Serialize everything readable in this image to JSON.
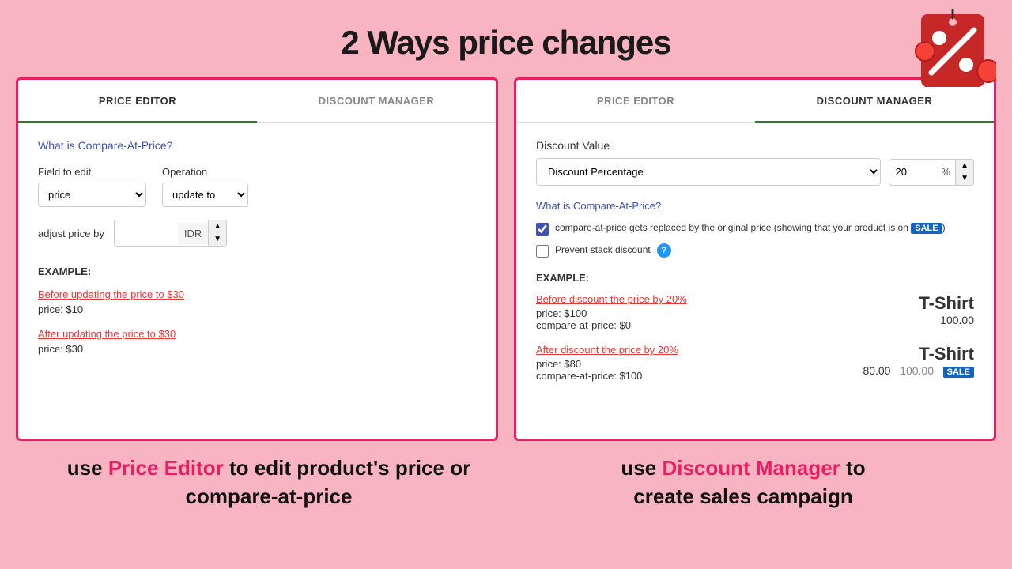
{
  "header": {
    "title": "2 Ways price changes"
  },
  "left_panel": {
    "tabs": [
      {
        "label": "PRICE EDITOR",
        "active": true
      },
      {
        "label": "DISCOUNT MANAGER",
        "active": false
      }
    ],
    "compare_at_price_link": "What is Compare-At-Price?",
    "field_to_edit_label": "Field to edit",
    "field_to_edit_value": "price",
    "operation_label": "Operation",
    "operation_value": "update to",
    "adjust_label": "adjust price by",
    "adjust_currency": "IDR",
    "example_label": "EXAMPLE:",
    "before_link": "Before updating the price to $30",
    "before_price": "price:  $10",
    "after_link": "After updating the price to $30",
    "after_price": "price:  $30"
  },
  "right_panel": {
    "tabs": [
      {
        "label": "PRICE EDITOR",
        "active": false
      },
      {
        "label": "DISCOUNT MANAGER",
        "active": true
      }
    ],
    "discount_value_label": "Discount Value",
    "discount_type": "Discount Percentage",
    "discount_number": "20",
    "discount_symbol": "%",
    "compare_at_price_link": "What is Compare-At-Price?",
    "checkbox1_label": "compare-at-price gets replaced by the original price (showing that your product is on SALE)",
    "checkbox1_checked": true,
    "checkbox2_label": "Prevent stack discount",
    "checkbox2_checked": false,
    "example_label": "EXAMPLE:",
    "before_discount_link": "Before discount the price by 20%",
    "before_price_line1": "price:  $100",
    "before_compare_line": "compare-at-price:  $0",
    "before_product_name": "T-Shirt",
    "before_product_price": "100.00",
    "after_discount_link": "After discount the price by 20%",
    "after_price_line1": "price:  $80",
    "after_compare_line": "compare-at-price:  $100",
    "after_product_name": "T-Shirt",
    "after_product_price_new": "80.00",
    "after_product_price_old": "100.00",
    "sale_badge": "SALE"
  },
  "bottom": {
    "left_text1": "use",
    "left_highlight": "Price Editor",
    "left_text2": "to edit product's price or",
    "left_text3": "compare-at-price",
    "right_text1": "use",
    "right_highlight": "Discount Manager",
    "right_text2": "to",
    "right_text3": "create sales campaign"
  }
}
